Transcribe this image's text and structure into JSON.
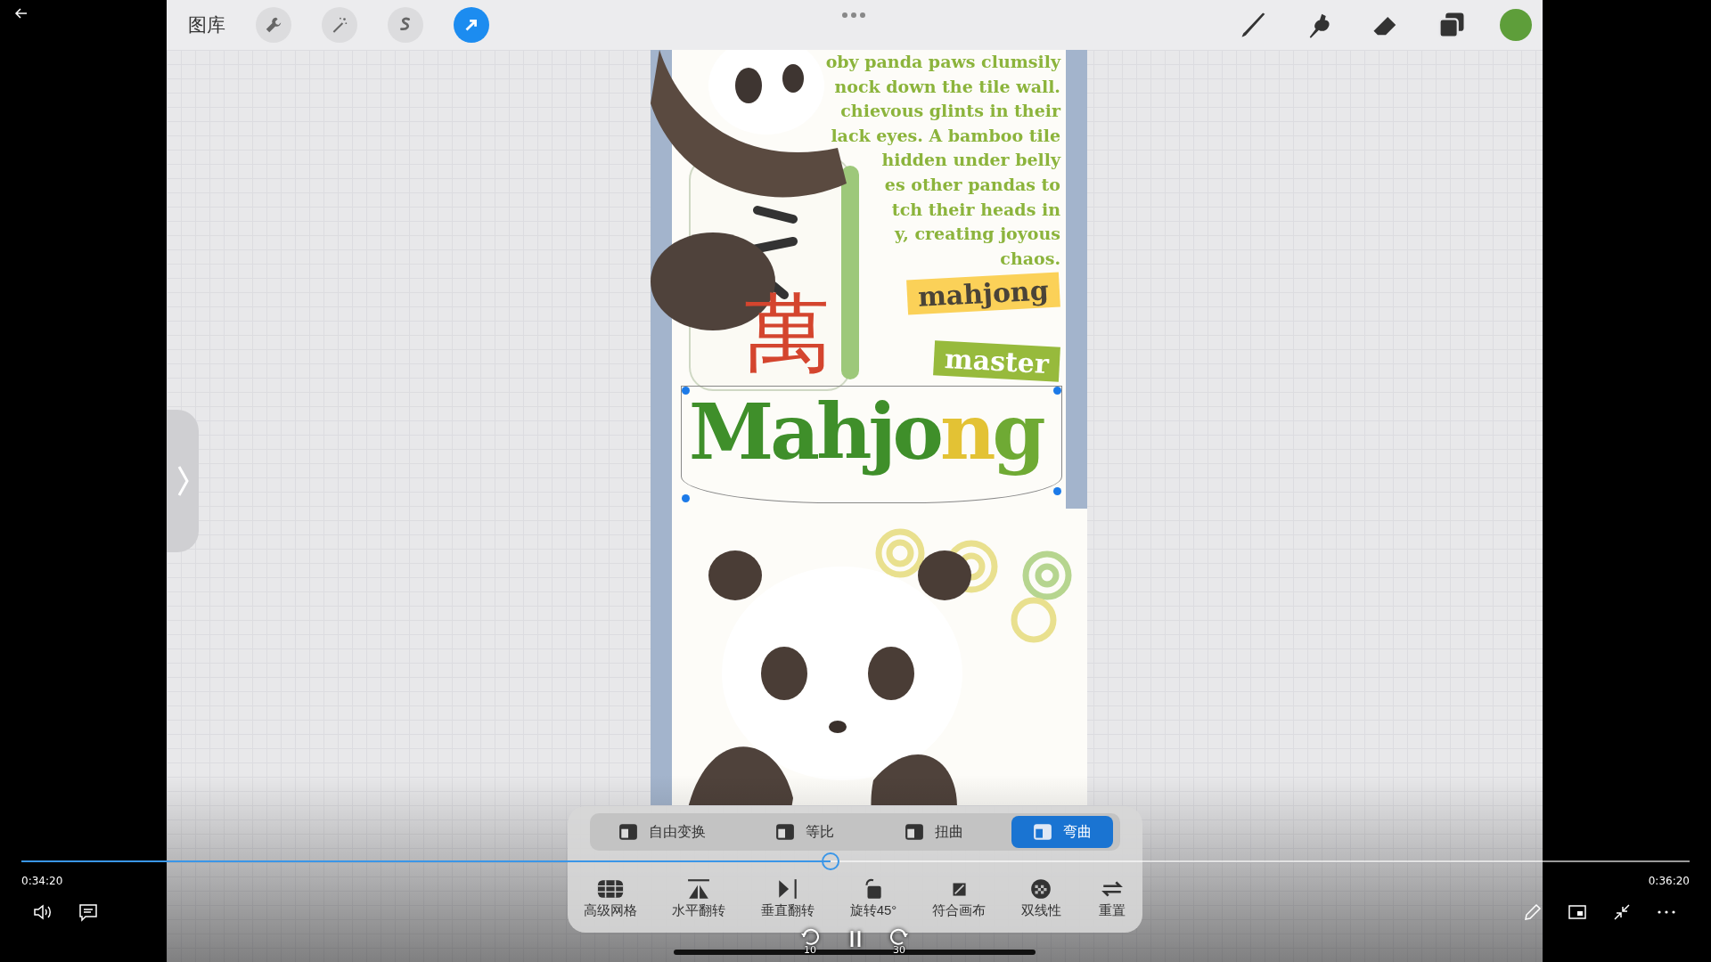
{
  "toolbar": {
    "gallery": "图库",
    "left_tools": [
      {
        "kind": "wrench",
        "selected": false
      },
      {
        "kind": "wand",
        "selected": false
      },
      {
        "kind": "selection",
        "selected": false
      },
      {
        "kind": "transform",
        "selected": true
      }
    ],
    "right_tools": [
      {
        "kind": "brush"
      },
      {
        "kind": "smudge"
      },
      {
        "kind": "eraser"
      },
      {
        "kind": "layers"
      }
    ],
    "color": "#5e9e3a"
  },
  "canvas": {
    "paragraph_lines": [
      "oby panda paws clumsily",
      "nock down the tile wall.",
      "chievous glints in their",
      "lack eyes. A bamboo tile",
      "hidden under belly",
      "es other pandas to",
      "tch their heads in",
      "y, creating joyous",
      "chaos."
    ],
    "tile_character": "萬",
    "tag_1": "mahjong",
    "tag_2": "master",
    "title": [
      {
        "text": "Mahjo",
        "color": "#3f8f2a"
      },
      {
        "text": "n",
        "color": "#e3c234"
      },
      {
        "text": "g",
        "color": "#6faa34"
      }
    ]
  },
  "transform_modes": [
    {
      "label": "自由变换",
      "selected": false
    },
    {
      "label": "等比",
      "selected": false
    },
    {
      "label": "扭曲",
      "selected": false
    },
    {
      "label": "弯曲",
      "selected": true
    }
  ],
  "transform_actions": [
    {
      "kind": "grid",
      "label": "高级网格"
    },
    {
      "kind": "flip-h",
      "label": "水平翻转"
    },
    {
      "kind": "flip-v",
      "label": "垂直翻转"
    },
    {
      "kind": "rotate",
      "label": "旋转45°"
    },
    {
      "kind": "fit",
      "label": "符合画布"
    },
    {
      "kind": "bilinear",
      "label": "双线性"
    },
    {
      "kind": "reset",
      "label": "重置"
    }
  ],
  "video": {
    "elapsed": "0:34:20",
    "total": "0:36:20",
    "level": 0.485,
    "rewind": "10",
    "forward": "30"
  }
}
